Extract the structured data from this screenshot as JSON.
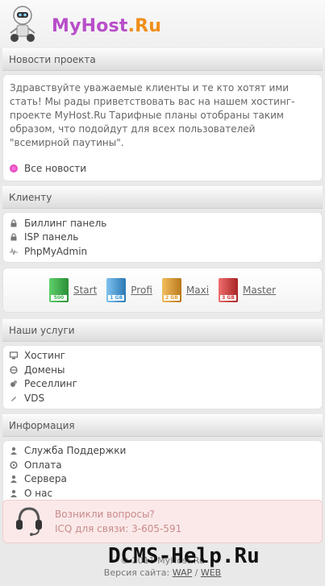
{
  "header": {
    "logo_part1": "MyHost",
    "logo_part2": ".Ru"
  },
  "news": {
    "title": "Новости проекта",
    "text": "Здравствуйте уважаемые клиенты и те кто хотят ими стать! Мы рады приветствовать вас на нашем хостинг-проекте MyHost.Ru Тарифные планы отобраны таким образом, что подойдут для всех пользователей \"всемирной паутины\".",
    "all_news": "Все новости"
  },
  "client": {
    "title": "Клиенту",
    "items": [
      {
        "label": "Биллинг панель",
        "icon": "lock-icon"
      },
      {
        "label": "ISP панель",
        "icon": "lock-icon"
      },
      {
        "label": "PhpMyAdmin",
        "icon": "pulse-icon"
      }
    ]
  },
  "plans": [
    {
      "label": "Start",
      "cap": "500",
      "color": "#3bb24a"
    },
    {
      "label": "Profi",
      "cap": "1 GB",
      "color": "#3a9bd8"
    },
    {
      "label": "Maxi",
      "cap": "2 GB",
      "color": "#e19a2a"
    },
    {
      "label": "Master",
      "cap": "3 GB",
      "color": "#d33b3b"
    }
  ],
  "services": {
    "title": "Наши услуги",
    "items": [
      {
        "label": "Хостинг",
        "icon": "monitor-icon"
      },
      {
        "label": "Домены",
        "icon": "globe-icon"
      },
      {
        "label": "Реселлинг",
        "icon": "tag-icon"
      },
      {
        "label": "VDS",
        "icon": "pencil-icon"
      }
    ]
  },
  "info": {
    "title": "Информация",
    "items": [
      {
        "label": "Служба Поддержки",
        "icon": "user-icon"
      },
      {
        "label": "Оплата",
        "icon": "gear-icon"
      },
      {
        "label": "Сервера",
        "icon": "user-icon"
      },
      {
        "label": "О нас",
        "icon": "user-icon"
      }
    ]
  },
  "contact": {
    "line1": "Возникли вопросы?",
    "line2": "ICQ для связи: 3-605-591"
  },
  "footer": {
    "copyright": "© 2011 MyHost.Ru",
    "version_prefix": "Версия сайта:",
    "wap": "WAP",
    "separator": "/",
    "web": "WEB"
  },
  "watermark": "DCMS-Help.Ru"
}
